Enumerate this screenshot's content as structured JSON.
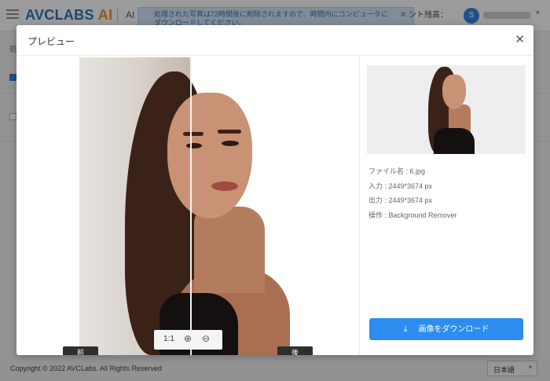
{
  "app": {
    "logo_main": "AVCLABS",
    "logo_ai": "AI",
    "nav_partial": "AI",
    "notice": "処理された写真は72時間後に削除されますので、時間内にコンピュータにダウンロードしてください。",
    "credits_label": "ント残高：",
    "avatar_letter": "S",
    "bg_label": "処",
    "copyright": "Copyright © 2022 AVCLabs. All Rights Reserved",
    "language": "日本語"
  },
  "modal": {
    "title": "プレビュー",
    "label_before": "前",
    "label_after": "後",
    "zoom_ratio": "1:1",
    "info": {
      "file_name": "ファイル名 : 6.jpg",
      "input": "入力 : 2449*3674 px",
      "output": "出力 : 2449*3674 px",
      "operation": "操作 : Background Remover"
    },
    "download_label": "画像をダウンロード"
  },
  "icons": {
    "menu": "hamburger-icon",
    "close": "close-icon",
    "zoom_in": "zoom-in-icon",
    "zoom_out": "zoom-out-icon",
    "download": "download-icon",
    "chevron": "chevron-down-icon"
  },
  "colors": {
    "brand_blue": "#2d6fb0",
    "brand_orange": "#e08a2a",
    "primary_button": "#2d8cf0"
  }
}
